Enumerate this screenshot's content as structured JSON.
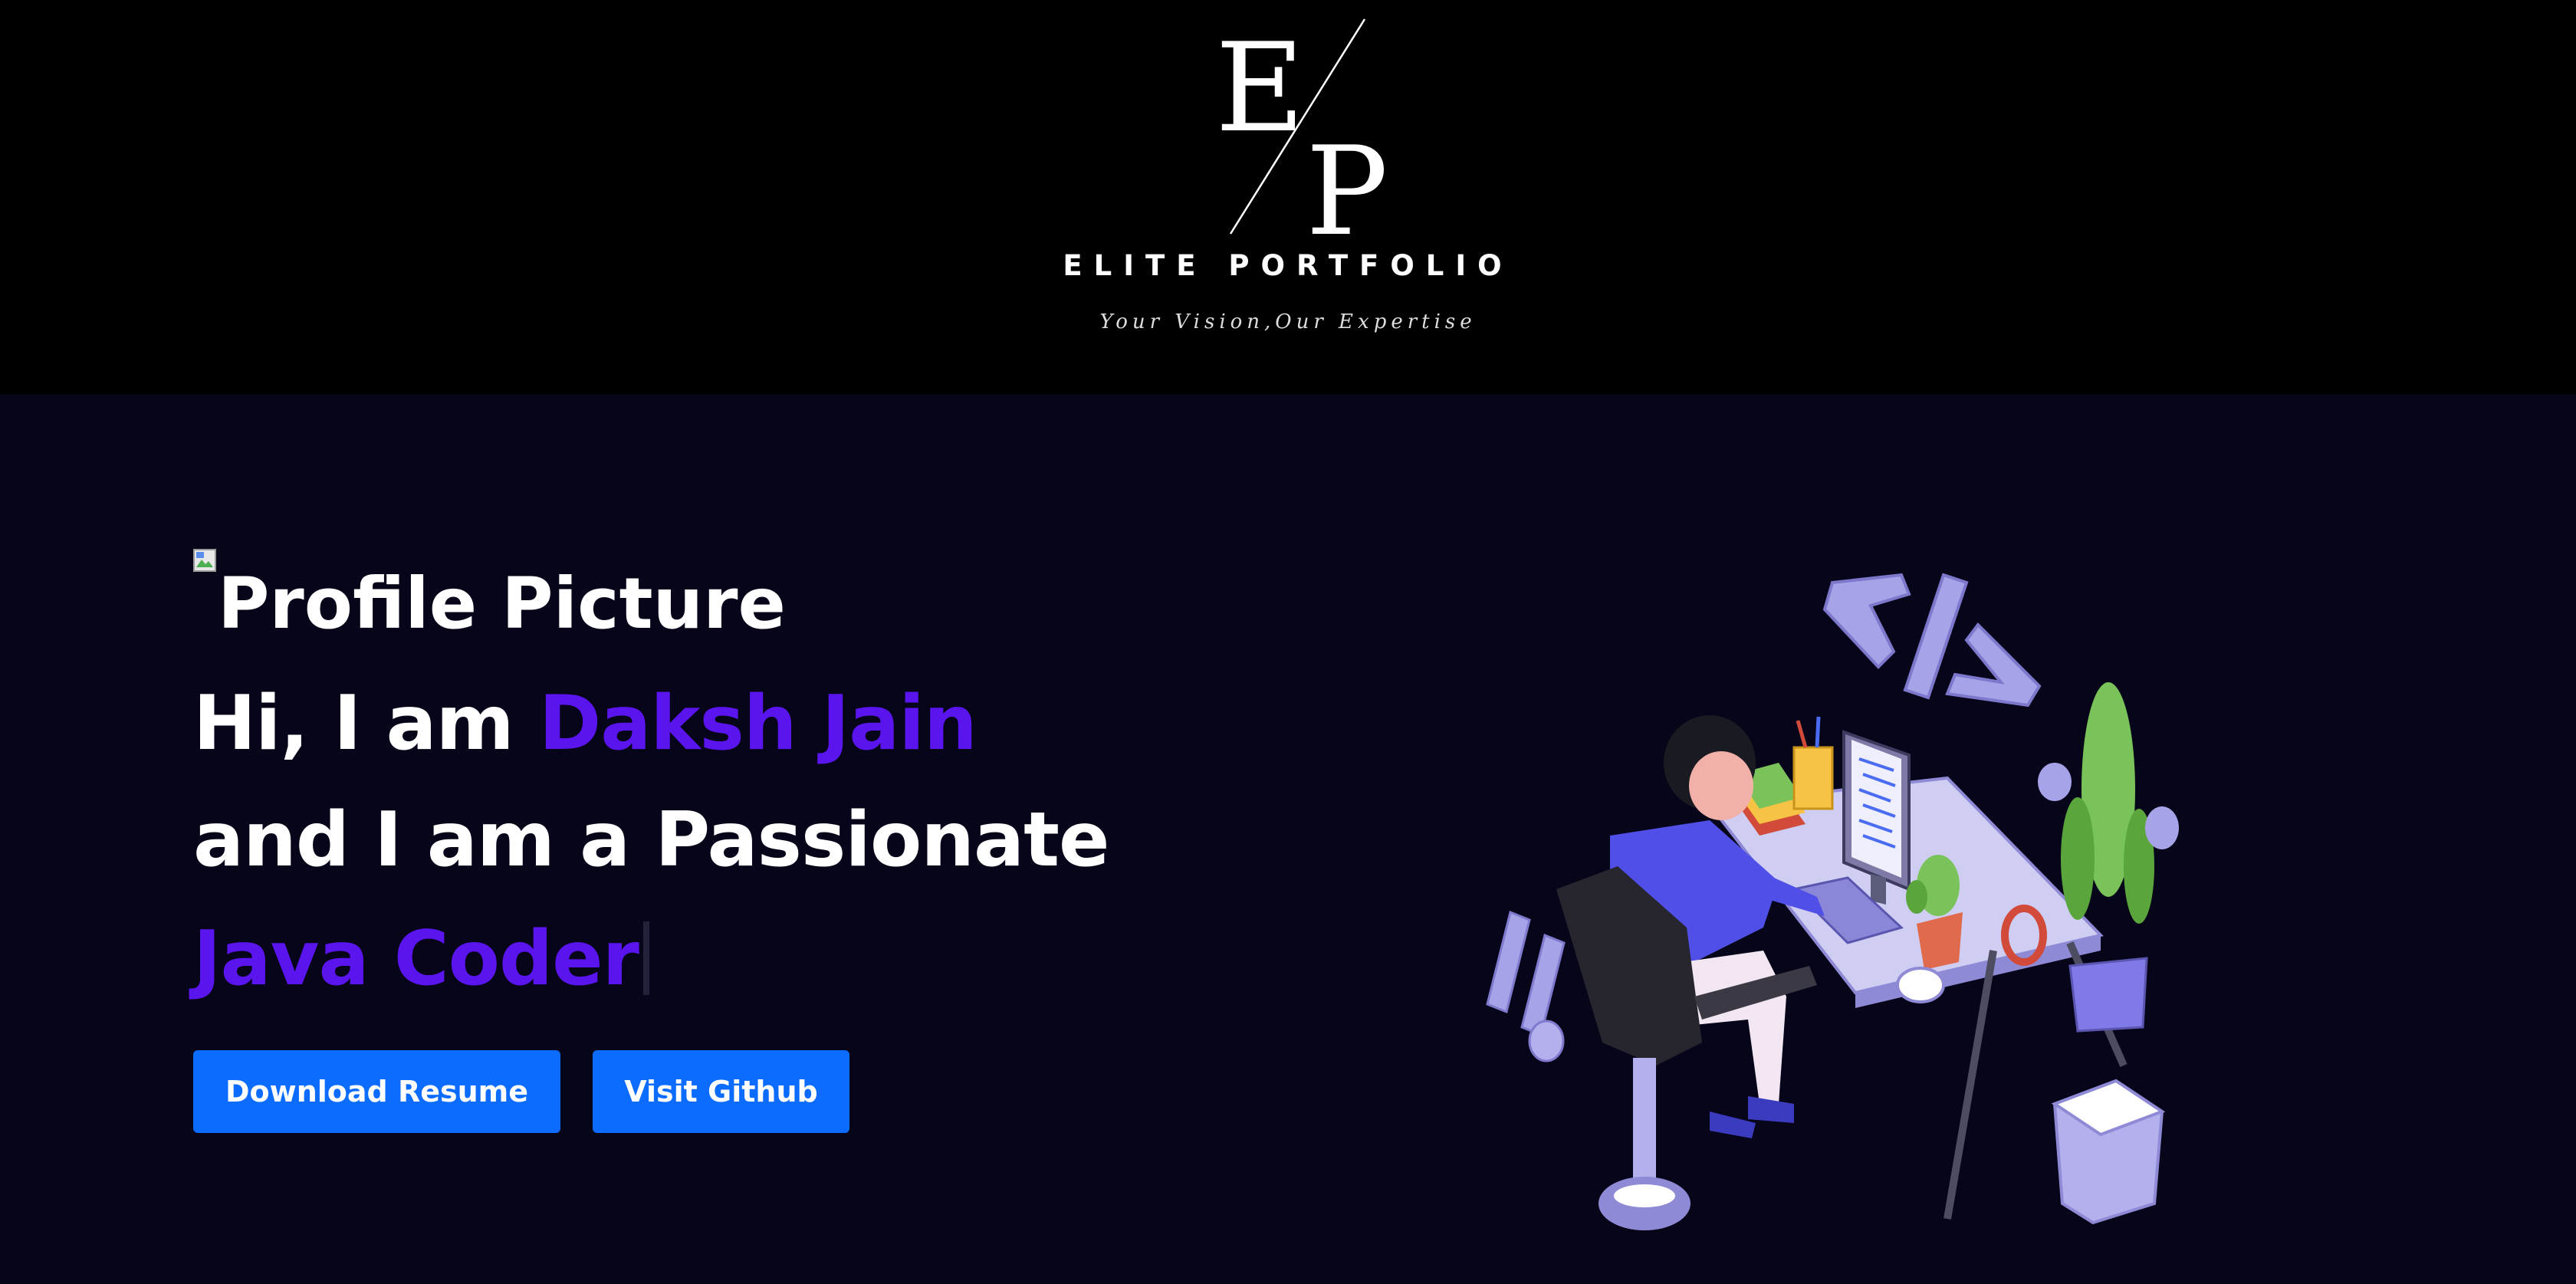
{
  "header": {
    "logo_letters": "E/P",
    "brand_name": "ELITE PORTFOLIO",
    "tagline": "Your Vision,Our Expertise"
  },
  "hero": {
    "profile_picture_alt": "Profile Picture",
    "greeting_prefix": "Hi, I am ",
    "name": "Daksh Jain",
    "line2": "and I am a Passionate",
    "typed_role": "Java Coder",
    "buttons": {
      "download_resume": "Download Resume",
      "visit_github": "Visit Github"
    }
  },
  "colors": {
    "header_bg": "#000000",
    "hero_bg": "#06051a",
    "accent": "#5a14ee",
    "button": "#0b6cff"
  }
}
